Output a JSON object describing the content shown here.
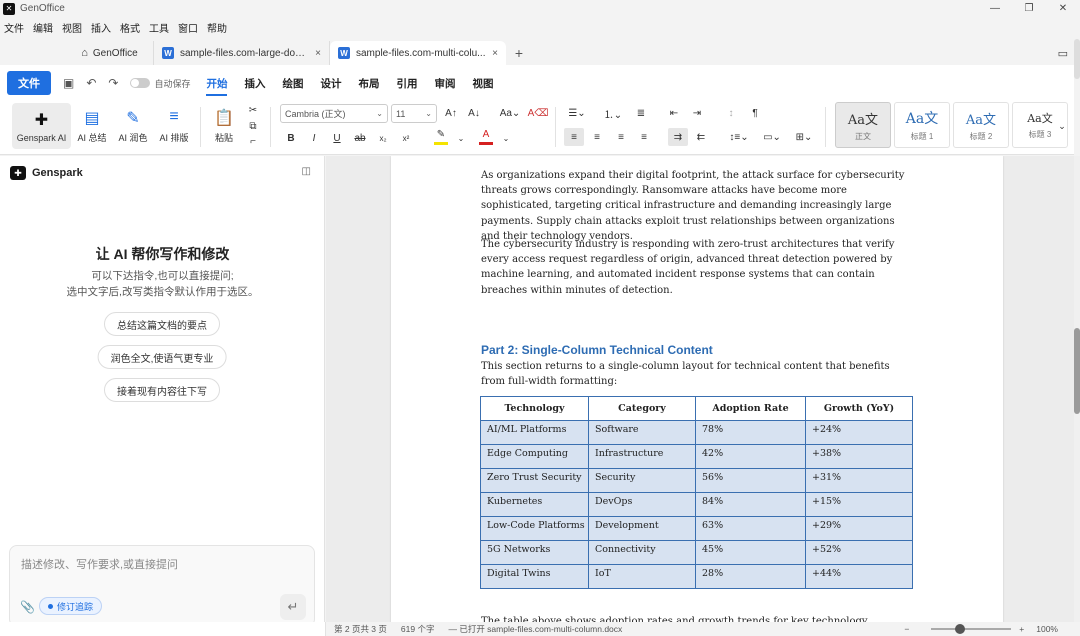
{
  "app": {
    "title": "GenOffice"
  },
  "window_controls": {
    "minimize": "—",
    "maximize": "❐",
    "close": "✕"
  },
  "menu": [
    "文件",
    "编辑",
    "视图",
    "插入",
    "格式",
    "工具",
    "窗口",
    "帮助"
  ],
  "tabs": {
    "home": "GenOffice",
    "doc1": "sample-files.com-large-docu...",
    "doc2": "sample-files.com-multi-colu...",
    "close": "×",
    "new": "+"
  },
  "ribbon": {
    "file": "文件",
    "autosave": "自动保存",
    "tabs": [
      "开始",
      "插入",
      "绘图",
      "设计",
      "布局",
      "引用",
      "审阅",
      "视图"
    ],
    "ai_buttons": [
      "Genspark AI",
      "AI 总结",
      "AI 润色",
      "AI 排版"
    ],
    "paste": "粘贴",
    "font": "Cambria (正文)",
    "size": "11",
    "styles": [
      {
        "preview": "Aa文",
        "label": "正文"
      },
      {
        "preview": "Aa文",
        "label": "标题 1"
      },
      {
        "preview": "Aa文",
        "label": "标题 2"
      },
      {
        "preview": "Aa文",
        "label": "标题 3"
      }
    ]
  },
  "panel": {
    "name": "Genspark",
    "title": "让 AI 帮你写作和修改",
    "sub1": "可以下达指令,也可以直接提问;",
    "sub2": "选中文字后,改写类指令默认作用于选区。",
    "chips": [
      "总结这篇文档的要点",
      "润色全文,使语气更专业",
      "接着现有内容往下写"
    ],
    "input_placeholder": "描述修改、写作要求,或直接提问",
    "track_label": "修订追踪"
  },
  "document": {
    "p1": "As organizations expand their digital footprint, the attack surface for cybersecurity threats grows correspondingly. Ransomware attacks have become more sophisticated, targeting critical infrastructure and demanding increasingly large payments. Supply chain attacks exploit trust relationships between organizations and their technology vendors.",
    "p2": "The cybersecurity industry is responding with zero-trust architectures that verify every access request regardless of origin, advanced threat detection powered by machine learning, and automated incident response systems that can contain breaches within minutes of detection.",
    "h2": "Part 2: Single-Column Technical Content",
    "p3": "This section returns to a single-column layout for technical content that benefits from full-width formatting:",
    "table": {
      "headers": [
        "Technology",
        "Category",
        "Adoption Rate",
        "Growth (YoY)"
      ],
      "rows": [
        [
          "AI/ML Platforms",
          "Software",
          "78%",
          "+24%"
        ],
        [
          "Edge Computing",
          "Infrastructure",
          "42%",
          "+38%"
        ],
        [
          "Zero Trust Security",
          "Security",
          "56%",
          "+31%"
        ],
        [
          "Kubernetes",
          "DevOps",
          "84%",
          "+15%"
        ],
        [
          "Low-Code Platforms",
          "Development",
          "63%",
          "+29%"
        ],
        [
          "5G Networks",
          "Connectivity",
          "45%",
          "+52%"
        ],
        [
          "Digital Twins",
          "IoT",
          "28%",
          "+44%"
        ]
      ]
    },
    "p4": "The table above shows adoption rates and growth trends for key technology categories."
  },
  "status": {
    "page": "第 2 页共 3 页",
    "words": "619 个字",
    "opened": "— 已打开 sample-files.com-multi-column.docx",
    "zoom": "100%"
  }
}
